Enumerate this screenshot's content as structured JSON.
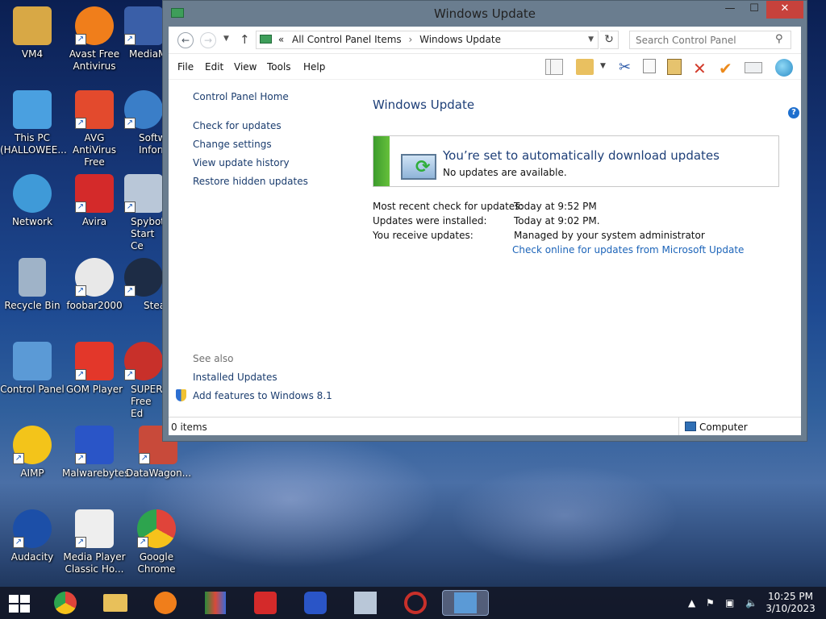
{
  "desktop_icons": [
    {
      "label": "VM4",
      "color": "#d8a845"
    },
    {
      "label": "Avast Free\nAntivirus",
      "color": "#f07e1b"
    },
    {
      "label": "MediaM",
      "color": "#3a5fa8"
    },
    {
      "label": "This PC\n(HALLOWEE...",
      "color": "#4aa0e0"
    },
    {
      "label": "AVG AntiVirus\nFree",
      "color": "#e34a2d"
    },
    {
      "label": "Softw\nInform",
      "color": "#3a7ec8"
    },
    {
      "label": "Network",
      "color": "#3f9ad8"
    },
    {
      "label": "Avira",
      "color": "#d42a2a"
    },
    {
      "label": "Spybot\nStart Ce",
      "color": "#b9c7d8"
    },
    {
      "label": "Recycle Bin",
      "color": "#9fb3c8"
    },
    {
      "label": "foobar2000",
      "color": "#e8e8e8"
    },
    {
      "label": "Stea",
      "color": "#1d2c45"
    },
    {
      "label": "Control Panel",
      "color": "#5b9ad6"
    },
    {
      "label": "GOM Player",
      "color": "#e3372a"
    },
    {
      "label": "SUPERA\nFree Ed",
      "color": "#c8302a"
    },
    {
      "label": "AIMP",
      "color": "#f3c41a"
    },
    {
      "label": "Malwarebytes",
      "color": "#2a55c7"
    },
    {
      "label": "DataWagon...",
      "color": "#c84a3a"
    },
    {
      "label": "Audacity",
      "color": "#1c4fa8"
    },
    {
      "label": "Media Player\nClassic Ho...",
      "color": "#eeeeee"
    },
    {
      "label": "Google\nChrome",
      "color": "#e0443a"
    }
  ],
  "window": {
    "title": "Windows Update",
    "min_label": "—",
    "max_label": "☐",
    "close_label": "✕"
  },
  "address": {
    "crumb_prefix": "«",
    "crumb_parent": "All Control Panel Items",
    "crumb_sep": "›",
    "crumb_current": "Windows Update",
    "search_placeholder": "Search Control Panel"
  },
  "menu": [
    "File",
    "Edit",
    "View",
    "Tools",
    "Help"
  ],
  "sidebar": {
    "home": "Control Panel Home",
    "links": [
      "Check for updates",
      "Change settings",
      "View update history",
      "Restore hidden updates"
    ],
    "see_also_label": "See also",
    "see_also_links": [
      "Installed Updates",
      "Add features to Windows 8.1"
    ]
  },
  "main": {
    "title": "Windows Update",
    "status_heading": "You’re set to automatically download updates",
    "status_sub": "No updates are available.",
    "info": [
      {
        "label": "Most recent check for updates:",
        "value": "Today at 9:52 PM"
      },
      {
        "label": "Updates were installed:",
        "value": "Today at 9:02 PM."
      },
      {
        "label": "You receive updates:",
        "value": "Managed by your system administrator"
      }
    ],
    "online_link": "Check online for updates from Microsoft Update"
  },
  "statusbar": {
    "items": "0 items",
    "location": "Computer"
  },
  "taskbar": {
    "time": "10:25 PM",
    "date": "3/10/2023"
  }
}
